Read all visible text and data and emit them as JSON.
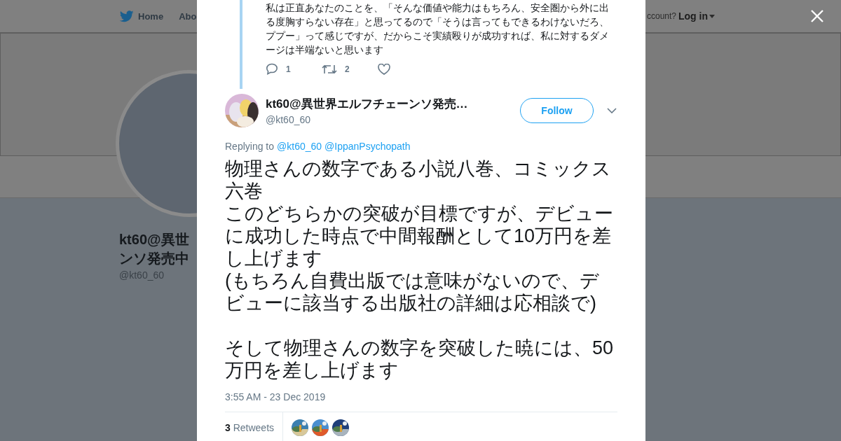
{
  "background_page": {
    "nav": [
      {
        "label": "Home"
      },
      {
        "label": "Abo"
      }
    ],
    "login_prompt": "ccount?",
    "login_label": "Log in",
    "profile_name_lines": [
      "kt60@異世",
      "ンソ発売中"
    ],
    "profile_handle": "@kt60_60"
  },
  "modal": {
    "quoted_tweet": {
      "text": "私は正直あなたのことを、「そんな価値や能力はもちろん、安全圏から外に出る度胸すらない存在」と思ってるので「そうは言ってもできるわけないだろ、ププー」って感じですが、だからこそ実績殴りが成功すれば、私に対するダメージは半端ないと思います",
      "reply_count": "1",
      "retweet_count": "2"
    },
    "tweet": {
      "author_name": "kt60@異世界エルフチェーンソ発売…",
      "author_handle": "@kt60_60",
      "follow_label": "Follow",
      "replying_label": "Replying to",
      "replying_to": [
        "@kt60_60",
        "@IppanPsychopath"
      ],
      "paragraphs": [
        {
          "lines": [
            "物理さんの数字である小説八巻、コミックス六巻",
            "このどちらかの突破が目標ですが、デビューに成功した時点で中間報酬として10万円を差し上げます",
            "(もちろん自費出版では意味がないので、デビューに該当する出版社の詳細は応相談で)"
          ]
        },
        {
          "lines": [
            "そして物理さんの数字を突破した暁には、50万円を差し上げます"
          ]
        }
      ],
      "timestamp": "3:55 AM - 23 Dec 2019",
      "retweet_count": "3",
      "retweet_label": "Retweets",
      "retweeters": [
        {
          "kind": "picture"
        },
        {
          "kind": "picture"
        },
        {
          "kind": "picture"
        }
      ]
    }
  }
}
